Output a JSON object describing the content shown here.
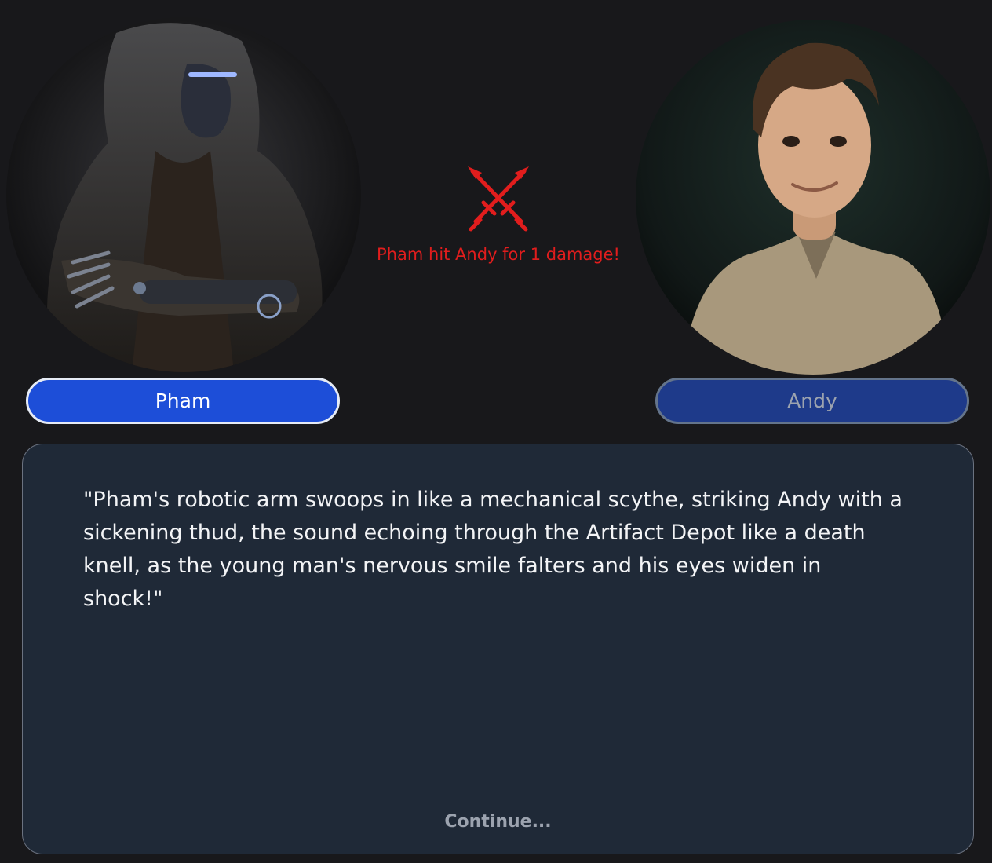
{
  "combatants": {
    "left": {
      "name": "Pham"
    },
    "right": {
      "name": "Andy"
    }
  },
  "battle": {
    "icon": "crossed-swords-icon",
    "message": "Pham hit Andy for 1 damage!",
    "accent_color": "#e11d1d"
  },
  "story": {
    "text": "\"Pham's robotic arm swoops in like a mechanical scythe, striking Andy with a sickening thud, the sound echoing through the Artifact Depot like a death knell, as the young man's nervous smile falters and his eyes widen in shock!\"",
    "continue_label": "Continue..."
  },
  "colors": {
    "active_button": "#1d4ed8",
    "inactive_button": "#1e3a8a",
    "panel": "#1f2937",
    "background": "#18181b"
  }
}
